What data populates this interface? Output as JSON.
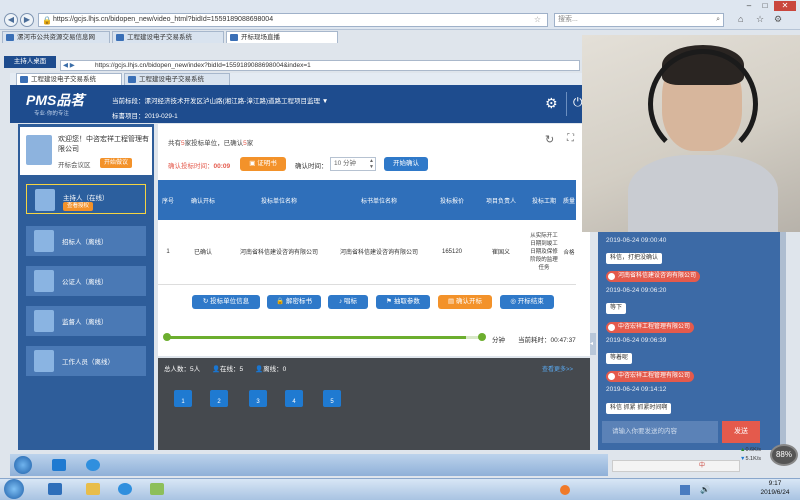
{
  "browser": {
    "url": "https://gcjs.lhjs.cn/bidopen_new/video_html?bidId=1559189088698004",
    "search_placeholder": "搜索...",
    "tabs": [
      "漯河市公共资源交易信息网",
      "工程建设电子交易系统",
      "开标现场直播"
    ],
    "inner_url": "https://gcjs.lhjs.cn/bidopen_new/index?bidId=1559189088698004&index=1",
    "inner_tabs": [
      "工程建设电子交易系统",
      "工程建设电子交易系统"
    ]
  },
  "host_badge": "主持人桌面",
  "header": {
    "logo": "PMS品茗",
    "logo_sub": "专业·你的专注",
    "current_bid_label": "当前标段：",
    "current_bid": "漯河经济技术开发区泸山路(湘江路-漳江路)道路工程项目监理",
    "project_label": "标書项目：",
    "project_code": "2019-029-1"
  },
  "welcome": {
    "text": "欢迎您！中咨宏祥工程管理有限公司",
    "role": "开标会议区",
    "status": "开始做议"
  },
  "participants": [
    {
      "label": "主持人（在线）",
      "badge": "查看授权"
    },
    {
      "label": "招标人（离线）"
    },
    {
      "label": "公证人（离线）"
    },
    {
      "label": "监督人（离线）"
    },
    {
      "label": "工作人员（离线）"
    }
  ],
  "main": {
    "summary_prefix": "共有",
    "summary_count_1": "5",
    "summary_mid": "家投标单位，已确认",
    "summary_count_2": "5",
    "summary_suffix": "家",
    "confirm_time_label": "确认投标时间：",
    "confirm_time_value": "00:09",
    "certify_button": "证明书",
    "confirm_limit_label": "确认时间：",
    "confirm_limit_value": "10 分钟",
    "start_button": "开始确认",
    "table": {
      "headers": [
        "序号",
        "确认开标",
        "投标单位名称",
        "标书单位名称",
        "投标报价",
        "项目负责人",
        "投标工期",
        "质量"
      ],
      "rows": [
        [
          "1",
          "已确认",
          "河南省科信建设咨询有限公司",
          "河南省科信建设咨询有限公司",
          "165120",
          "崔国义",
          "从实际开工日期到竣工日期及保修阶段的监理任务",
          "合格"
        ]
      ]
    },
    "actions": [
      "投标单位信息",
      "解密标书",
      "唱标",
      "抽取参数",
      "确认开标",
      "开标结束"
    ],
    "progress_unit": "分钟",
    "elapsed_label": "当前耗时：",
    "elapsed_value": "00:47:37",
    "progress_fraction": 0.95
  },
  "footer": {
    "total_label": "总人数：",
    "total_value": "5人",
    "online_label": "在线：",
    "online_value": "5",
    "offline_label": "离线：",
    "offline_value": "0",
    "more_link": "查看更多>>",
    "seats": [
      "1",
      "2",
      "3",
      "4",
      "5"
    ]
  },
  "chat": {
    "messages": [
      {
        "time": "2019-06-24 09:00:40",
        "text": "科信，打把没确认"
      },
      {
        "name": "河南省科信建设咨询有限公司",
        "time": "2019-06-24 09:06:20",
        "text": "等下"
      },
      {
        "name": "中咨宏祥工程管理有限公司",
        "time": "2019-06-24 09:06:39",
        "text": "等着呢"
      },
      {
        "name": "中咨宏祥工程管理有限公司",
        "time": "2019-06-24 09:14:12",
        "text": "科信 抓紧 抓紧时间啊"
      }
    ],
    "input_placeholder": "请输入你要发送的内容",
    "send_button": "发送"
  },
  "tray": {
    "percent": "88%",
    "up_speed": "0.6K/s",
    "down_speed": "5.1K/s",
    "time": "9:17",
    "date": "2019/6/24",
    "ime": "中"
  },
  "colors": {
    "brand": "#1e4c8e",
    "accent": "#f3922a",
    "alert": "#e45a4c"
  }
}
